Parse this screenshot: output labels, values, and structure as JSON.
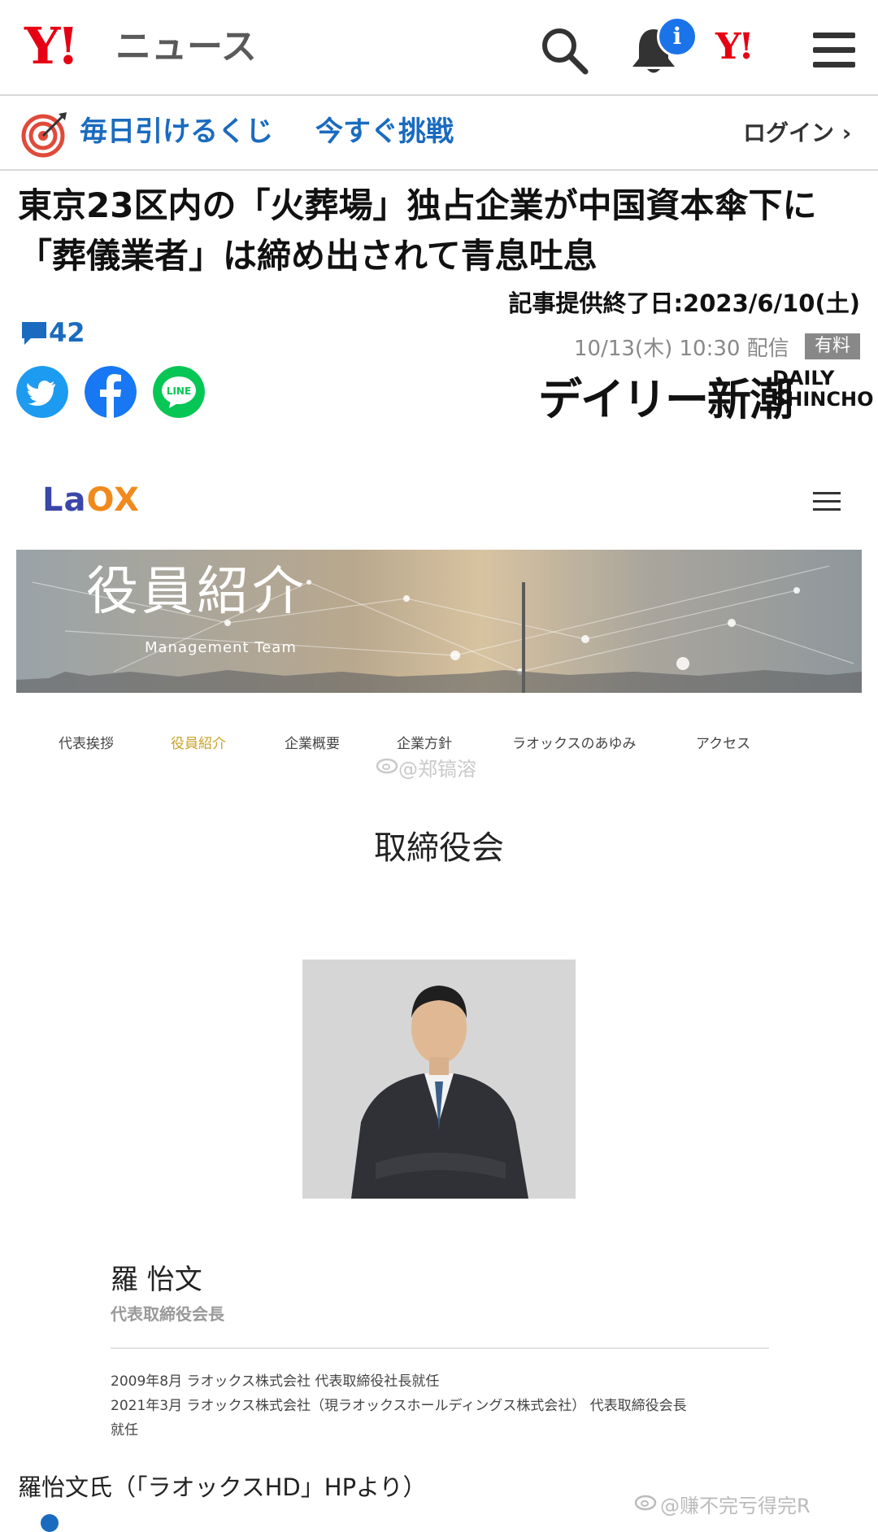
{
  "header": {
    "logo_y": "Y!",
    "logo_news": "ニュース",
    "notification_badge": "i",
    "y_small": "Y!"
  },
  "promo": {
    "text": "毎日引けるくじ",
    "cta": "今すぐ挑戦",
    "login": "ログイン ›"
  },
  "article": {
    "headline": "東京23区内の「火葬場」独占企業が中国資本傘下に　「葬儀業者」は締め出されて青息吐息",
    "end_date": "記事提供終了日:2023/6/10(土)",
    "comment_count": "42",
    "pub_time": "10/13(木) 10:30 配信",
    "paid_badge": "有料",
    "source_jp": "デイリー新潮",
    "source_en_1": "DAILY",
    "source_en_2": "SHINCHO",
    "social_line_label": "LINE"
  },
  "screenshot": {
    "logo_la": "La",
    "logo_ox": "OX",
    "banner_title": "役員紹介",
    "banner_sub": "Management Team",
    "nav": [
      "代表挨拶",
      "役員紹介",
      "企業概要",
      "企業方針",
      "ラオックスのあゆみ",
      "アクセス"
    ],
    "active_nav_color": "#c9a227",
    "watermark": "@郑镐溶",
    "section_title": "取締役会",
    "person_name": "羅 怡文",
    "person_title": "代表取締役会長",
    "career": [
      "2009年8月 ラオックス株式会社 代表取締役社長就任",
      "2021年3月 ラオックス株式会社（現ラオックスホールディングス株式会社） 代表取締役会長",
      "就任"
    ]
  },
  "caption": "羅怡文氏（「ラオックスHD」HPより）",
  "watermark_bottom": "@赚不完亏得完R",
  "colors": {
    "brand_red": "#e60013",
    "link_blue": "#1a6bbf",
    "twitter": "#1d9bf0",
    "facebook": "#1877f2",
    "line": "#06c755"
  }
}
